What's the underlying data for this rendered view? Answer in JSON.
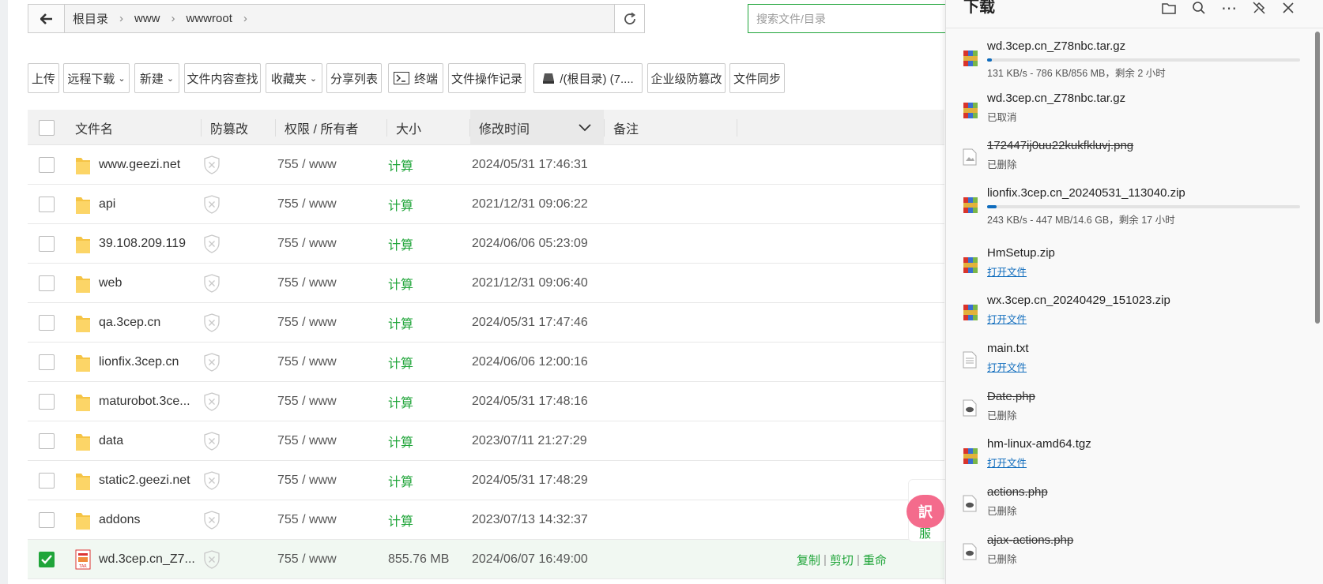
{
  "breadcrumb": {
    "items": [
      "根目录",
      "www",
      "wwwroot"
    ]
  },
  "search": {
    "placeholder": "搜索文件/目录"
  },
  "toolbar": {
    "buttons": [
      "上传",
      "远程下载",
      "新建",
      "文件内容查找",
      "收藏夹",
      "分享列表",
      "终端",
      "文件操作记录",
      "/(根目录) (7....",
      "企业级防篡改",
      "文件同步"
    ]
  },
  "table": {
    "headers": {
      "name": "文件名",
      "protect": "防篡改",
      "perm": "权限 / 所有者",
      "size": "大小",
      "mtime": "修改时间",
      "note": "备注"
    },
    "rows": [
      {
        "name": "www.geezi.net",
        "perm": "755 / www",
        "size": "计算",
        "mtime": "2024/05/31 17:46:31"
      },
      {
        "name": "api",
        "perm": "755 / www",
        "size": "计算",
        "mtime": "2021/12/31 09:06:22"
      },
      {
        "name": "39.108.209.119",
        "perm": "755 / www",
        "size": "计算",
        "mtime": "2024/06/06 05:23:09"
      },
      {
        "name": "web",
        "perm": "755 / www",
        "size": "计算",
        "mtime": "2021/12/31 09:06:40"
      },
      {
        "name": "qa.3cep.cn",
        "perm": "755 / www",
        "size": "计算",
        "mtime": "2024/05/31 17:47:46"
      },
      {
        "name": "lionfix.3cep.cn",
        "perm": "755 / www",
        "size": "计算",
        "mtime": "2024/06/06 12:00:16"
      },
      {
        "name": "maturobot.3ce...",
        "perm": "755 / www",
        "size": "计算",
        "mtime": "2024/05/31 17:48:16"
      },
      {
        "name": "data",
        "perm": "755 / www",
        "size": "计算",
        "mtime": "2023/07/11 21:27:29"
      },
      {
        "name": "static2.geezi.net",
        "perm": "755 / www",
        "size": "计算",
        "mtime": "2024/05/31 17:48:29"
      },
      {
        "name": "addons",
        "perm": "755 / www",
        "size": "计算",
        "mtime": "2023/07/13 14:32:37"
      },
      {
        "name": "wd.3cep.cn_Z7...",
        "perm": "755 / www",
        "size": "855.76 MB",
        "mtime": "2024/06/07 16:49:00"
      }
    ],
    "selected_actions": [
      "复制",
      "剪切",
      "重命"
    ]
  },
  "float": {
    "translate_label": "訳",
    "kefu_label": "服"
  },
  "downloads": {
    "title": "下载",
    "items": [
      {
        "name": "wd.3cep.cn_Z78nbc.tar.gz",
        "status": "131 KB/s - 786 KB/856 MB，剩余 2 小时",
        "progress": 0.001,
        "icon": "archive-icon",
        "state": "downloading"
      },
      {
        "name": "wd.3cep.cn_Z78nbc.tar.gz",
        "status": "已取消",
        "icon": "archive-icon",
        "state": "cancelled"
      },
      {
        "name": "172447ij0uu22kukfkluvj.png",
        "status": "已删除",
        "icon": "image-file-icon",
        "state": "deleted"
      },
      {
        "name": "lionfix.3cep.cn_20240531_113040.zip",
        "status": "243 KB/s - 447 MB/14.6 GB，剩余 17 小时",
        "progress": 0.03,
        "icon": "archive-icon",
        "state": "downloading"
      },
      {
        "name": "HmSetup.zip",
        "status": "打开文件",
        "icon": "archive-icon",
        "state": "done"
      },
      {
        "name": "wx.3cep.cn_20240429_151023.zip",
        "status": "打开文件",
        "icon": "archive-icon",
        "state": "done"
      },
      {
        "name": "main.txt",
        "status": "打开文件",
        "icon": "text-file-icon",
        "state": "done"
      },
      {
        "name": "Date.php",
        "status": "已删除",
        "icon": "php-file-icon",
        "state": "deleted"
      },
      {
        "name": "hm-linux-amd64.tgz",
        "status": "打开文件",
        "icon": "archive-icon",
        "state": "done"
      },
      {
        "name": "actions.php",
        "status": "已删除",
        "icon": "php-file-icon",
        "state": "deleted"
      },
      {
        "name": "ajax-actions.php",
        "status": "已删除",
        "icon": "php-file-icon",
        "state": "deleted"
      }
    ]
  },
  "colors": {
    "accent": "#20a53a",
    "link": "#0f6cbd",
    "float": "#f46b8c"
  }
}
